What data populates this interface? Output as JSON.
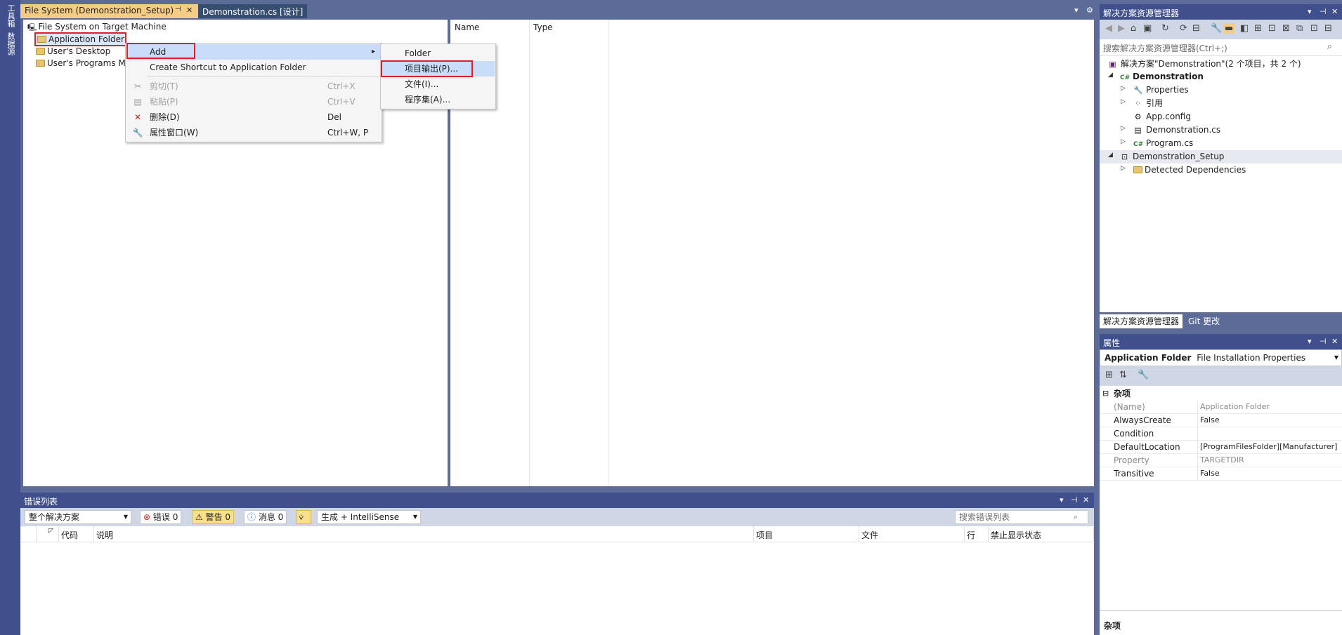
{
  "left_toolbar": {
    "tabs": [
      "工具箱",
      "数据源"
    ]
  },
  "doc_tabs": [
    {
      "label": "File System (Demonstration_Setup)",
      "pin": "⊣",
      "close": "✕"
    },
    {
      "label": "Demonstration.cs [设计]"
    }
  ],
  "fs_tree": {
    "root": "File System on Target Machine",
    "items": [
      "Application Folder",
      "User's Desktop",
      "User's Programs M"
    ]
  },
  "fs_list": {
    "columns": [
      "Name",
      "Type"
    ]
  },
  "context_menu": {
    "items": [
      {
        "label": "Add",
        "shortcut": "",
        "submenu_arrow": "▸"
      },
      {
        "label": "Create Shortcut to Application Folder",
        "shortcut": ""
      },
      {
        "label": "剪切(T)",
        "shortcut": "Ctrl+X",
        "icon": "scissors-icon"
      },
      {
        "label": "粘贴(P)",
        "shortcut": "Ctrl+V",
        "icon": "paste-icon"
      },
      {
        "label": "删除(D)",
        "shortcut": "Del",
        "icon": "delete-icon"
      },
      {
        "label": "属性窗口(W)",
        "shortcut": "Ctrl+W, P",
        "icon": "wrench-icon"
      }
    ]
  },
  "add_submenu": {
    "items": [
      "Folder",
      "项目输出(P)...",
      "文件(I)...",
      "程序集(A)..."
    ]
  },
  "error_list": {
    "title": "错误列表",
    "scope": "整个解决方案",
    "errors": "错误 0",
    "warnings": "警告 0",
    "messages": "消息 0",
    "build_filter": "生成 + IntelliSense",
    "search_placeholder": "搜索错误列表",
    "columns": [
      "代码",
      "说明",
      "项目",
      "文件",
      "行",
      "禁止显示状态"
    ]
  },
  "solution_explorer": {
    "title": "解决方案资源管理器",
    "search_placeholder": "搜索解决方案资源管理器(Ctrl+;)",
    "solution_label": "解决方案\"Demonstration\"(2 个项目，共 2 个)",
    "project1": "Demonstration",
    "project1_items": [
      "Properties",
      "引用",
      "App.config",
      "Demonstration.cs",
      "Program.cs"
    ],
    "project2": "Demonstration_Setup",
    "project2_items": [
      "Detected Dependencies"
    ],
    "bottom_tabs": [
      "解决方案资源管理器",
      "Git 更改"
    ]
  },
  "properties": {
    "title": "属性",
    "object_name": "Application Folder",
    "object_type": "File Installation Properties",
    "category": "杂项",
    "rows": [
      {
        "key": "(Name)",
        "value": "Application Folder"
      },
      {
        "key": "AlwaysCreate",
        "value": "False"
      },
      {
        "key": "Condition",
        "value": ""
      },
      {
        "key": "DefaultLocation",
        "value": "[ProgramFilesFolder][Manufacturer]"
      },
      {
        "key": "Property",
        "value": "TARGETDIR"
      },
      {
        "key": "Transitive",
        "value": "False"
      }
    ],
    "desc_title": "杂项"
  }
}
